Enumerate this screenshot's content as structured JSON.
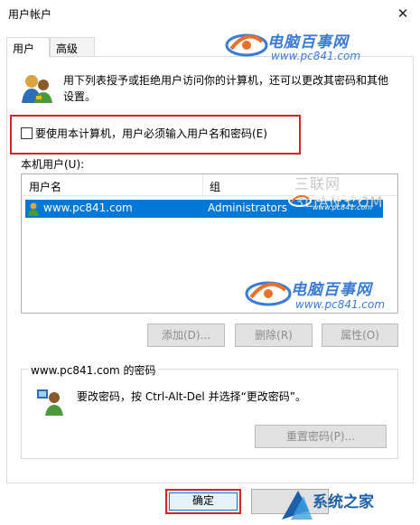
{
  "window": {
    "title": "用户帐户",
    "close_label": "✕"
  },
  "tabs": [
    {
      "label": "用户",
      "active": true
    },
    {
      "label": "高级",
      "active": false
    }
  ],
  "description": "用下列表授予或拒绝用户访问你的计算机，还可以更改其密码和其他设置。",
  "require_login": {
    "label": "要使用本计算机，用户必须输入用户名和密码(E)",
    "checked": false
  },
  "users_list": {
    "label": "本机用户(U):",
    "columns": [
      "用户名",
      "组"
    ],
    "rows": [
      {
        "name": "www.pc841.com",
        "group": "Administrators",
        "selected": true
      }
    ]
  },
  "buttons": {
    "add": "添加(D)...",
    "remove": "删除(R)",
    "properties": "属性(O)",
    "reset_password": "重置密码(P)...",
    "ok": "确定",
    "cancel": ""
  },
  "password_group": {
    "title": "www.pc841.com 的密码",
    "text": "要改密码，按 Ctrl-Alt-Del 并选择“更改密码”。"
  },
  "watermarks": {
    "site_title": "电脑百事网",
    "site_url": "www.pc841.com",
    "sanlian": "三联网 3LIAN.COM",
    "xitong": "系统之家"
  },
  "colors": {
    "selection": "#0078d7",
    "highlight_box": "#d5232a",
    "watermark_blue": "#3a7bd5"
  }
}
